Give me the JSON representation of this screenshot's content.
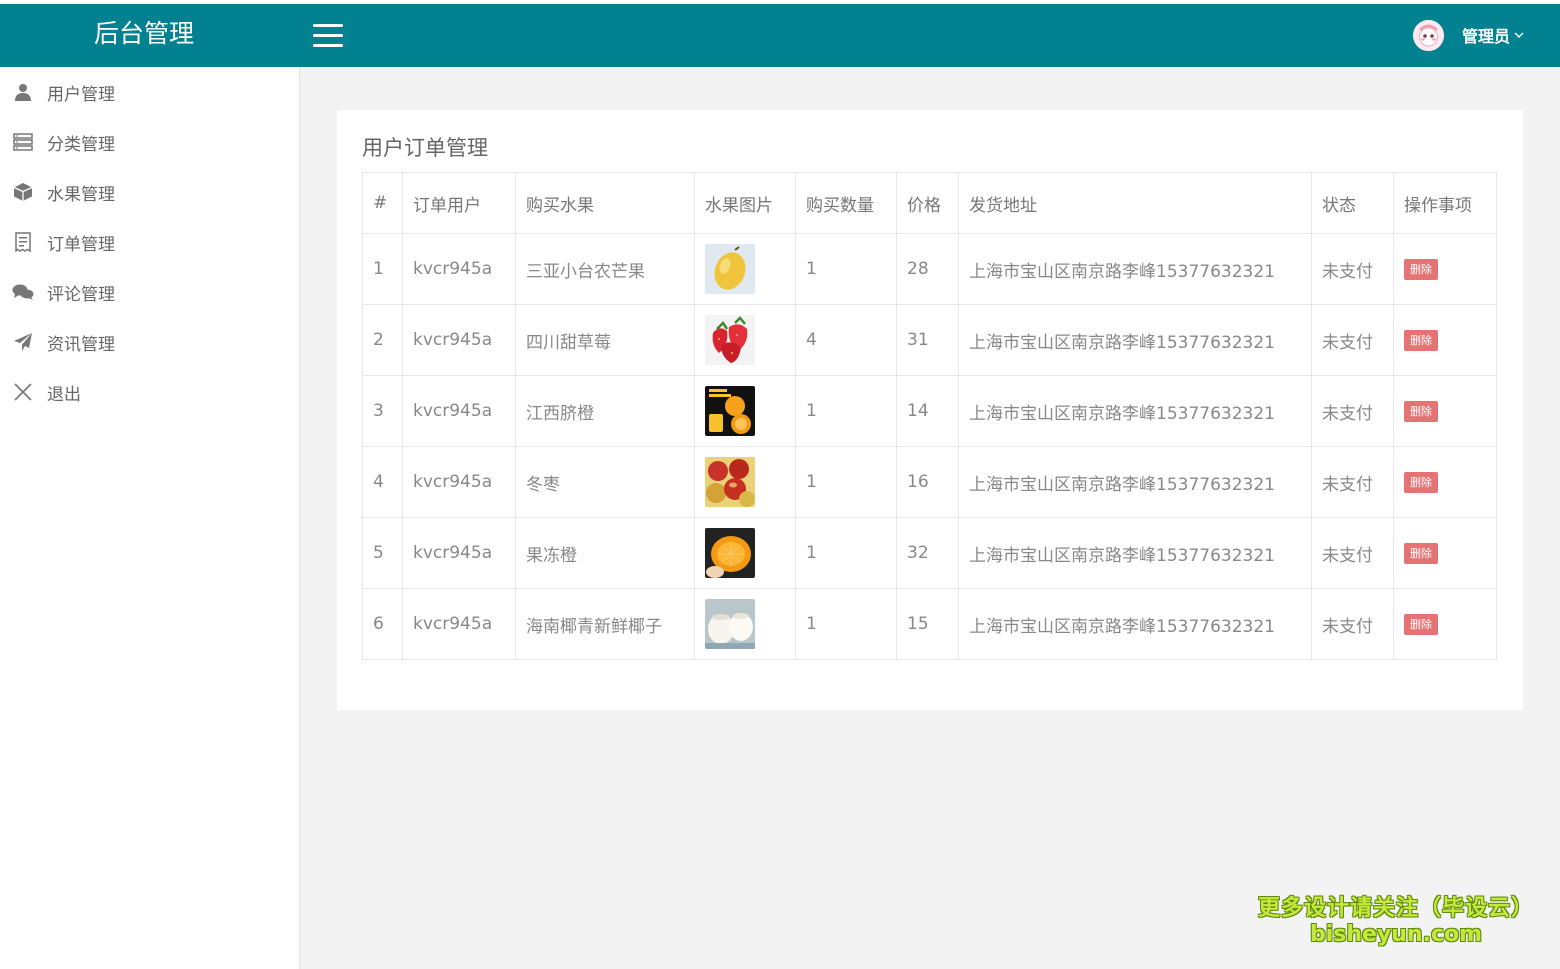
{
  "header": {
    "brand": "后台管理",
    "user_name": "管理员"
  },
  "sidebar": {
    "items": [
      {
        "label": "用户管理",
        "icon": "user-icon"
      },
      {
        "label": "分类管理",
        "icon": "list-icon"
      },
      {
        "label": "水果管理",
        "icon": "cube-icon"
      },
      {
        "label": "订单管理",
        "icon": "receipt-icon"
      },
      {
        "label": "评论管理",
        "icon": "comments-icon"
      },
      {
        "label": "资讯管理",
        "icon": "paper-plane-icon"
      },
      {
        "label": "退出",
        "icon": "close-icon"
      }
    ]
  },
  "main": {
    "title": "用户订单管理",
    "columns": [
      "#",
      "订单用户",
      "购买水果",
      "水果图片",
      "购买数量",
      "价格",
      "发货地址",
      "状态",
      "操作事项"
    ],
    "rows": [
      {
        "id": "1",
        "user": "kvcr945a",
        "fruit": "三亚小台农芒果",
        "image": "mango",
        "qty": "1",
        "price": "28",
        "address": "上海市宝山区南京路李峰15377632321",
        "status": "未支付",
        "action": "删除"
      },
      {
        "id": "2",
        "user": "kvcr945a",
        "fruit": "四川甜草莓",
        "image": "strawberry",
        "qty": "4",
        "price": "31",
        "address": "上海市宝山区南京路李峰15377632321",
        "status": "未支付",
        "action": "删除"
      },
      {
        "id": "3",
        "user": "kvcr945a",
        "fruit": "江西脐橙",
        "image": "navel-orange",
        "qty": "1",
        "price": "14",
        "address": "上海市宝山区南京路李峰15377632321",
        "status": "未支付",
        "action": "删除"
      },
      {
        "id": "4",
        "user": "kvcr945a",
        "fruit": "冬枣",
        "image": "winter-jujube",
        "qty": "1",
        "price": "16",
        "address": "上海市宝山区南京路李峰15377632321",
        "status": "未支付",
        "action": "删除"
      },
      {
        "id": "5",
        "user": "kvcr945a",
        "fruit": "果冻橙",
        "image": "jelly-orange",
        "qty": "1",
        "price": "32",
        "address": "上海市宝山区南京路李峰15377632321",
        "status": "未支付",
        "action": "删除"
      },
      {
        "id": "6",
        "user": "kvcr945a",
        "fruit": "海南椰青新鲜椰子",
        "image": "coconut",
        "qty": "1",
        "price": "15",
        "address": "上海市宝山区南京路李峰15377632321",
        "status": "未支付",
        "action": "删除"
      }
    ]
  },
  "watermark": {
    "line1": "更多设计请关注（毕设云）",
    "line2": "bisheyun.com"
  },
  "colors": {
    "header": "#028290",
    "delete_button": "#e57373"
  }
}
